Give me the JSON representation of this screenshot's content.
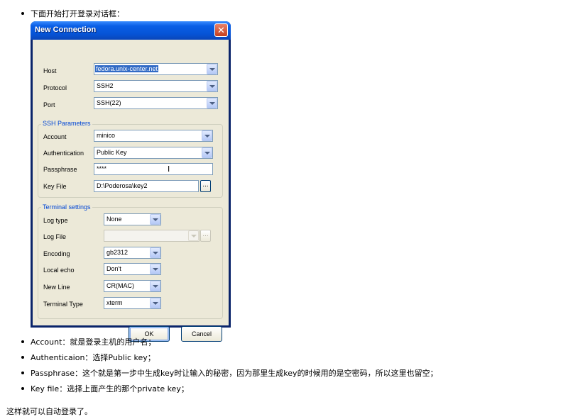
{
  "intro": "下面开始打开登录对话框：",
  "dialog": {
    "title": "New Connection",
    "host_label": "Host",
    "host_value": "fedora.unix-center.net",
    "protocol_label": "Protocol",
    "protocol_value": "SSH2",
    "port_label": "Port",
    "port_value": "SSH(22)",
    "ssh_group_title": "SSH Parameters",
    "account_label": "Account",
    "account_value": "minico",
    "auth_label": "Authentication",
    "auth_value": "Public Key",
    "passphrase_label": "Passphrase",
    "passphrase_value": "****",
    "keyfile_label": "Key File",
    "keyfile_value": "D:\\Poderosa\\key2",
    "browse_label": "...",
    "terminal_group_title": "Terminal settings",
    "logtype_label": "Log type",
    "logtype_value": "None",
    "logfile_label": "Log File",
    "logfile_value": "",
    "encoding_label": "Encoding",
    "encoding_value": "gb2312",
    "localecho_label": "Local echo",
    "localecho_value": "Don't",
    "newline_label": "New Line",
    "newline_value": "CR(MAC)",
    "termtype_label": "Terminal Type",
    "termtype_value": "xterm",
    "ok_label": "OK",
    "cancel_label": "Cancel",
    "close_glyph": "✕"
  },
  "notes": [
    "Account：就是登录主机的用户名；",
    "Authenticaion：选择Public key；",
    "Passphrase：这个就是第一步中生成key时让输入的秘密，因为那里生成key的时候用的是空密码，所以这里也留空；",
    "Key file：选择上面产生的那个private key；"
  ],
  "footer": "这样就可以自动登录了。",
  "colors": {
    "titlebar": "#0a5fe6",
    "face": "#ece9d8",
    "group_title": "#0046d5",
    "selection": "#316ac5"
  }
}
